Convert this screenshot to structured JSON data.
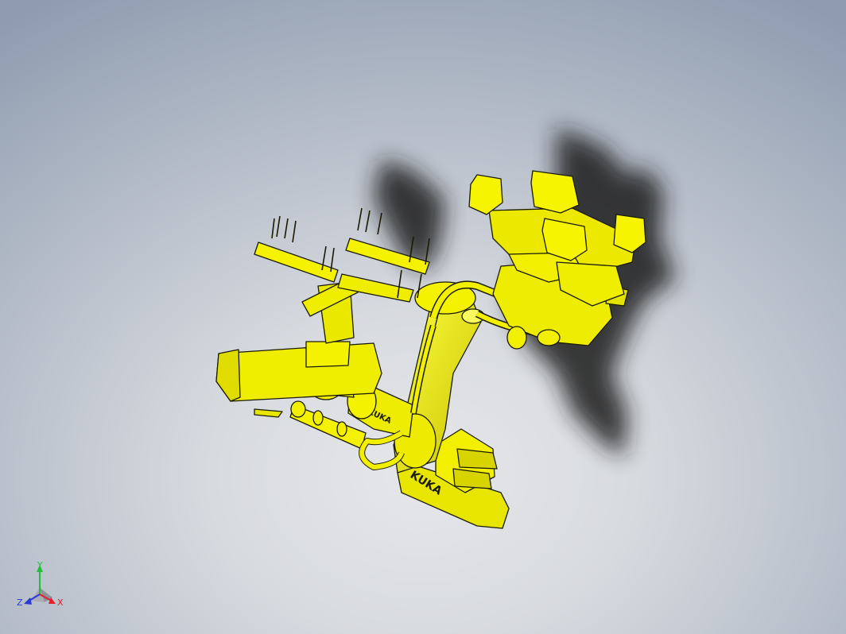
{
  "model": {
    "brand_text": "KUKA",
    "part_color": "#f2f000",
    "edge_color": "#1a1a00",
    "shadow_color": "#1c1c1c"
  },
  "triad": {
    "x_label": "X",
    "y_label": "Y",
    "z_label": "Z",
    "x_color": "#e0202a",
    "y_color": "#1fbf3a",
    "z_color": "#2a38d8"
  }
}
